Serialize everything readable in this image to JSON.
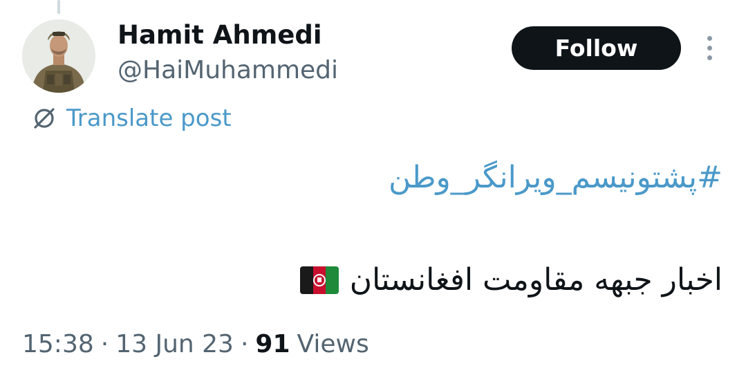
{
  "author": {
    "display_name": "Hamit Ahmedi",
    "handle": "@HaiMuhammedi",
    "avatar_icon": "soldier-avatar"
  },
  "actions": {
    "follow_label": "Follow",
    "more_icon": "vertical-ellipsis-icon"
  },
  "translate": {
    "icon": "globe-slash-icon",
    "label": "Translate post"
  },
  "post": {
    "hashtag": "#پشتونیسم_ویرانگر_وطن",
    "text": "اخبار جبهه مقاومت افغانستان",
    "emoji": "afghanistan-flag-icon"
  },
  "meta": {
    "time": "15:38",
    "separator": "·",
    "date": "13 Jun 23",
    "views_count": "91",
    "views_label": "Views"
  },
  "colors": {
    "link": "#4a99c9",
    "button_bg": "#0f1419",
    "secondary_text": "#536471"
  }
}
